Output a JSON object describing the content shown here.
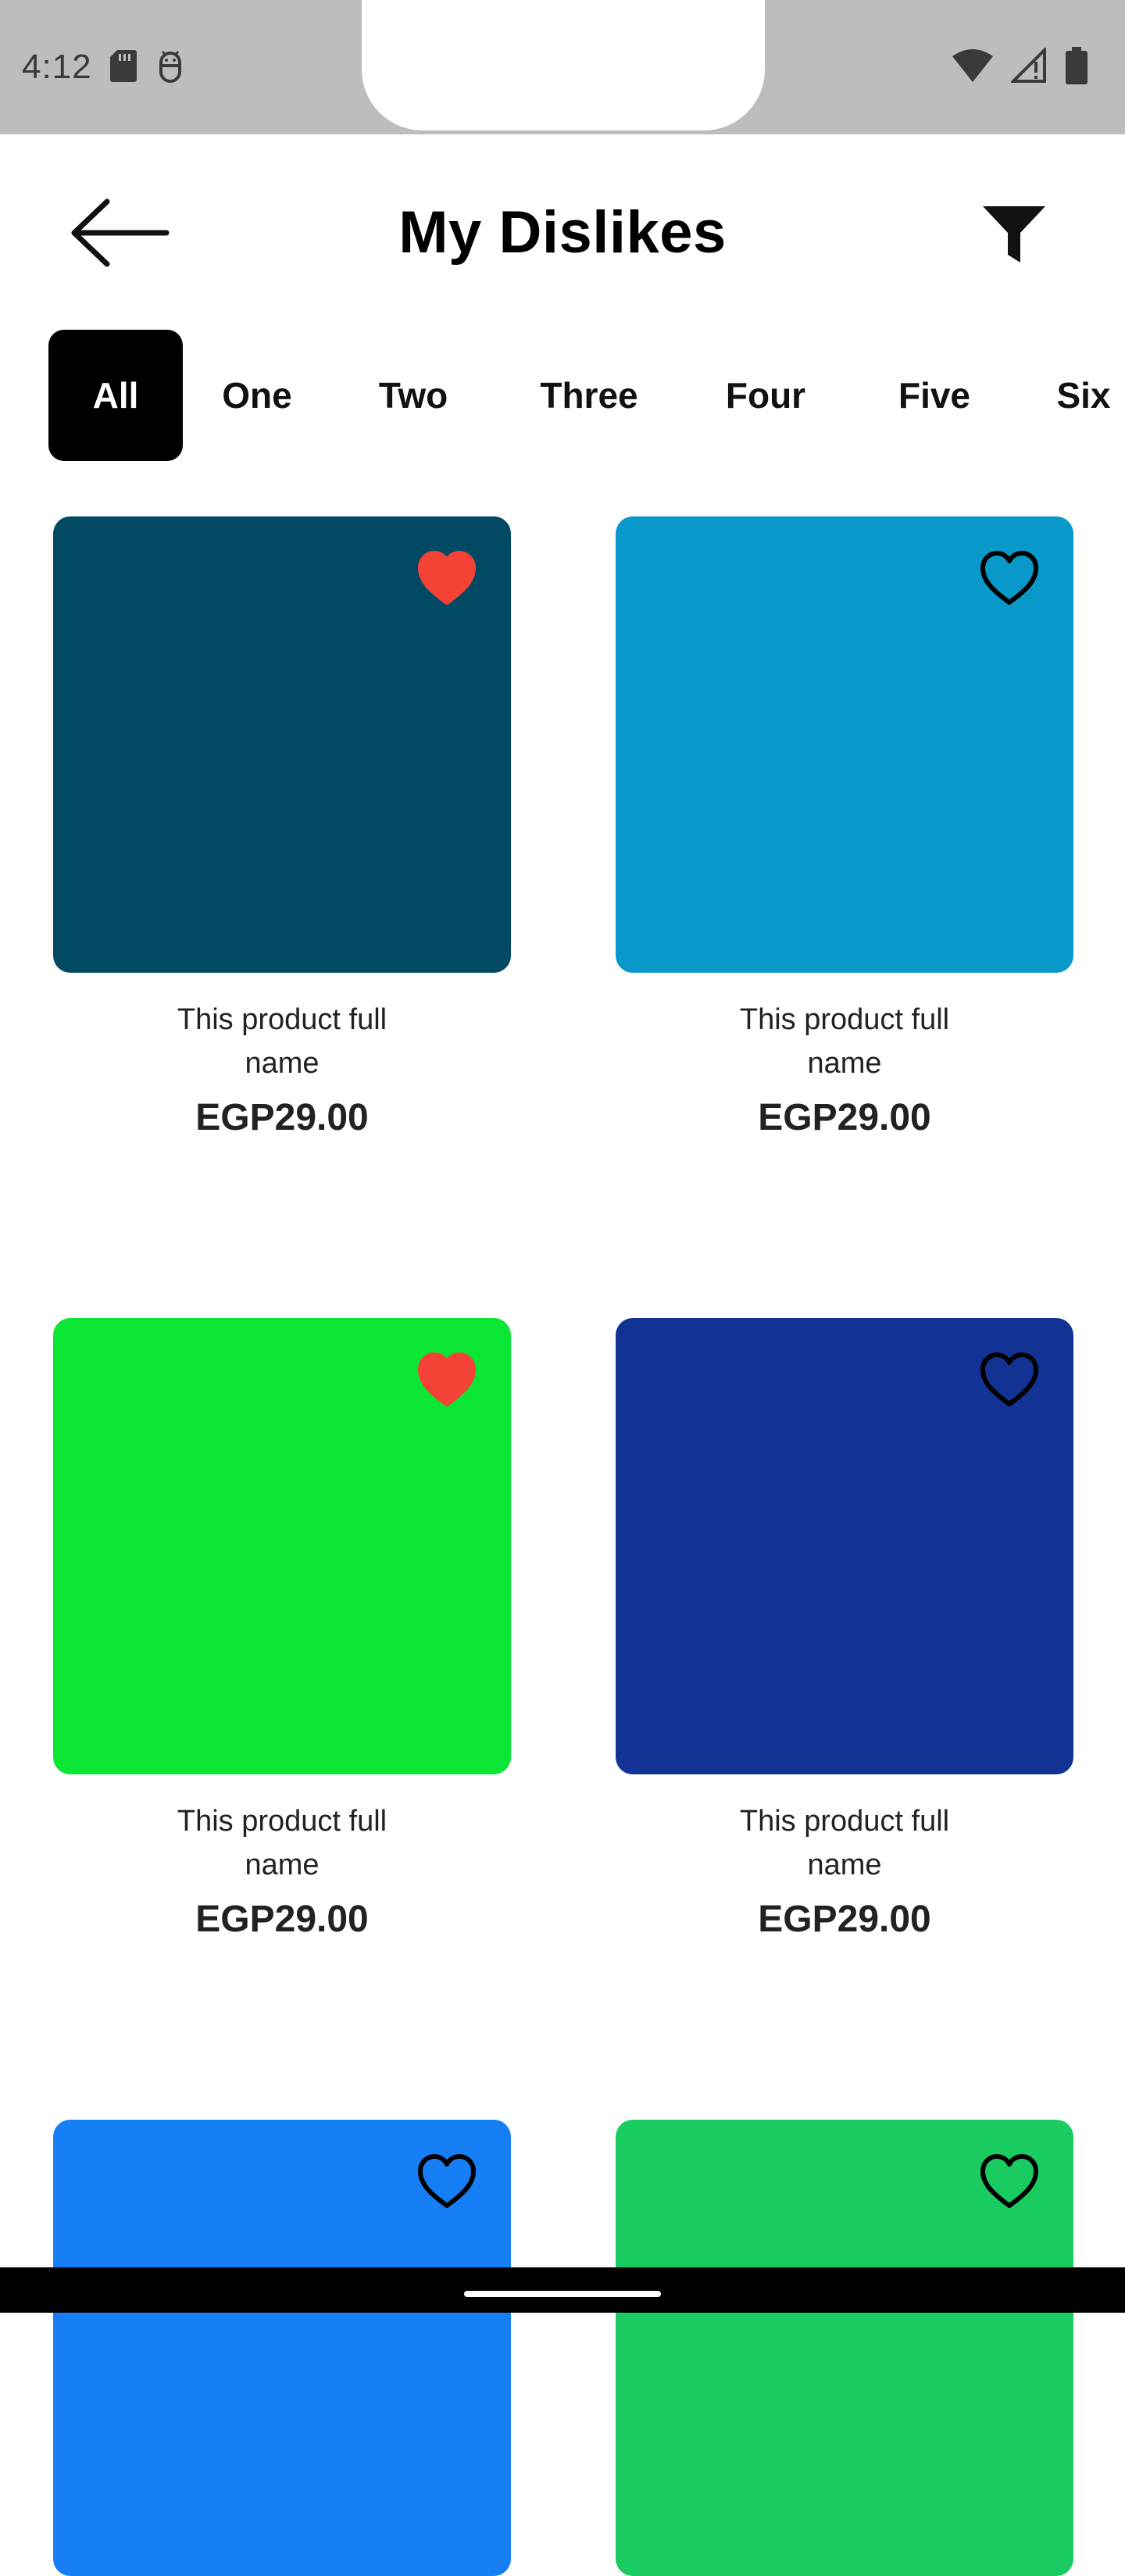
{
  "status_bar": {
    "time": "4:12",
    "left_icons": [
      "sd-card-icon",
      "android-debug-icon"
    ],
    "right_icons": [
      "wifi-icon",
      "signal-icon",
      "battery-icon"
    ]
  },
  "header": {
    "title": "My Dislikes",
    "back_icon": "arrow-left-icon",
    "filter_icon": "filter-icon"
  },
  "tabs": [
    {
      "label": "All",
      "active": true
    },
    {
      "label": "One",
      "active": false
    },
    {
      "label": "Two",
      "active": false
    },
    {
      "label": "Three",
      "active": false
    },
    {
      "label": "Four",
      "active": false
    },
    {
      "label": "Five",
      "active": false
    },
    {
      "label": "Six",
      "active": false
    }
  ],
  "products": [
    {
      "name": "This product full name",
      "price": "EGP29.00",
      "color": "#024a63",
      "favorited": true
    },
    {
      "name": "This product full name",
      "price": "EGP29.00",
      "color": "#0898ca",
      "favorited": false
    },
    {
      "name": "This product full name",
      "price": "EGP29.00",
      "color": "#0be634",
      "favorited": true
    },
    {
      "name": "This product full name",
      "price": "EGP29.00",
      "color": "#123394",
      "favorited": false
    },
    {
      "name": "",
      "price": "",
      "color": "#177ff6",
      "favorited": false
    },
    {
      "name": "",
      "price": "",
      "color": "#1acb62",
      "favorited": false
    }
  ],
  "colors": {
    "favorite_active": "#f44336",
    "favorite_outline": "#000000",
    "tab_active_bg": "#000000",
    "status_bar_bg": "#bdbdbd"
  }
}
